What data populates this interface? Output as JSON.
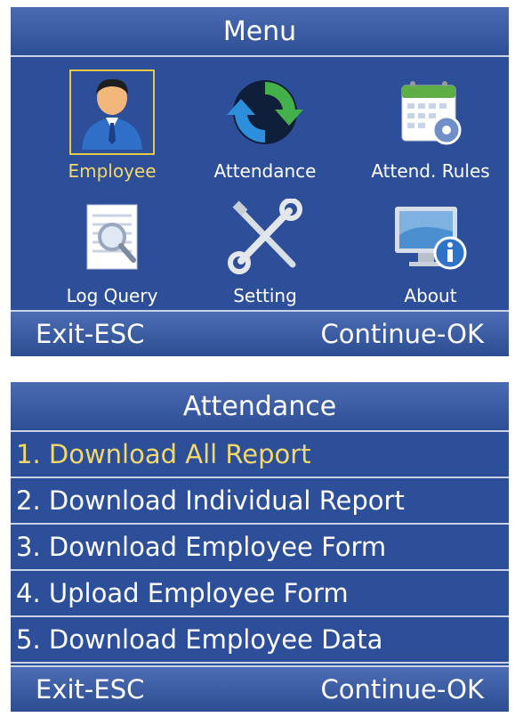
{
  "menu": {
    "title": "Menu",
    "items": [
      {
        "label": "Employee",
        "icon": "employee-icon",
        "selected": true
      },
      {
        "label": "Attendance",
        "icon": "attendance-sync-icon",
        "selected": false
      },
      {
        "label": "Attend. Rules",
        "icon": "calendar-rules-icon",
        "selected": false
      },
      {
        "label": "Log Query",
        "icon": "log-query-icon",
        "selected": false
      },
      {
        "label": "Setting",
        "icon": "wrench-screwdriver-icon",
        "selected": false
      },
      {
        "label": "About",
        "icon": "monitor-info-icon",
        "selected": false
      }
    ],
    "footer": {
      "exit": "Exit-ESC",
      "continue": "Continue-OK"
    }
  },
  "attendance": {
    "title": "Attendance",
    "items": [
      {
        "label": "1. Download All Report",
        "active": true
      },
      {
        "label": "2. Download Individual Report",
        "active": false
      },
      {
        "label": "3. Download Employee Form",
        "active": false
      },
      {
        "label": "4. Upload Employee Form",
        "active": false
      },
      {
        "label": "5. Download Employee Data",
        "active": false
      }
    ],
    "footer": {
      "exit": "Exit-ESC",
      "continue": "Continue-OK"
    }
  },
  "colors": {
    "background": "#2d4f9a",
    "highlight": "#f2d86a",
    "text": "#ffffff"
  }
}
